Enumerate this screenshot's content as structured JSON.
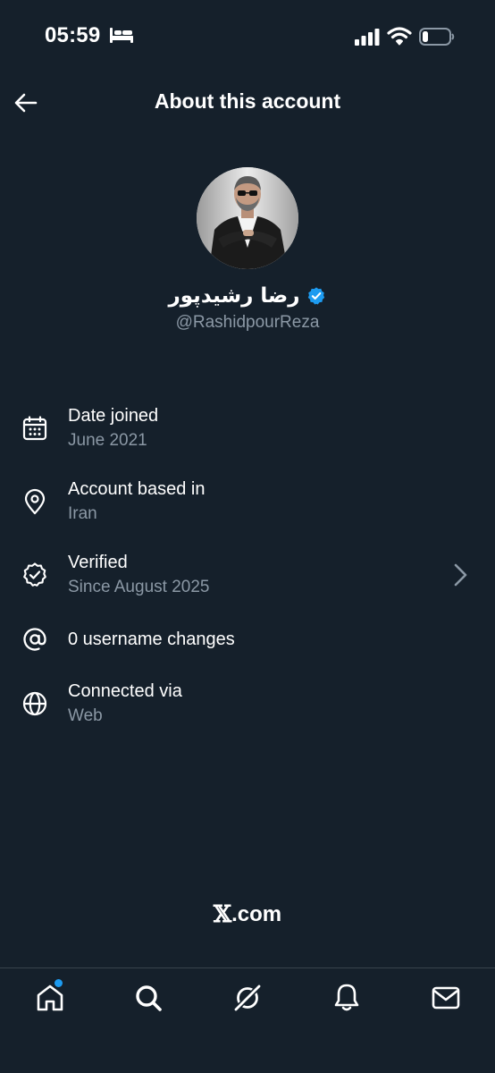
{
  "status_bar": {
    "time": "05:59"
  },
  "header": {
    "title": "About this account"
  },
  "profile": {
    "display_name": "رضا رشیدپور",
    "handle": "@RashidpourReza",
    "verified_color": "#1d9bf0"
  },
  "info": {
    "date_joined": {
      "title": "Date joined",
      "value": "June 2021"
    },
    "account_based": {
      "title": "Account based in",
      "value": "Iran"
    },
    "verified": {
      "title": "Verified",
      "value": "Since August 2025"
    },
    "username_changes": {
      "title": "0 username changes"
    },
    "connected_via": {
      "title": "Connected via",
      "value": "Web"
    }
  },
  "footer": {
    "link_mark": "𝕏",
    "link_suffix": ".com"
  },
  "bottom_nav": {
    "items": [
      "home-icon",
      "search-icon",
      "grok-icon",
      "notifications-icon",
      "messages-icon"
    ],
    "home_has_notification": true
  },
  "colors": {
    "background": "#15202b",
    "secondary_text": "#8b98a5",
    "accent": "#1d9bf0"
  }
}
